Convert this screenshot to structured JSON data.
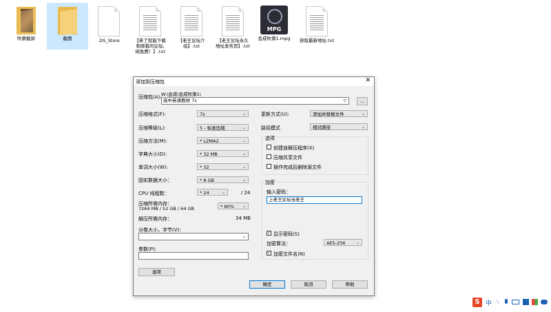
{
  "desktop": {
    "items": [
      {
        "label": "吹箫截屏"
      },
      {
        "label": "截图"
      },
      {
        "label": ".DS_Store"
      },
      {
        "label": "【来了就能下载\n和观看的论坛,\n纯免费！】.txt"
      },
      {
        "label": "【老王论坛介\n绍】.txt"
      },
      {
        "label": "【老王论坛永久\n地址发布页】.txt"
      },
      {
        "label": "会成吹箫1.mpg",
        "icon_text": "MPG"
      },
      {
        "label": "获取最新地址.txt"
      }
    ]
  },
  "dialog": {
    "title": "添加到压缩包",
    "close": "✕",
    "archive_label": "压缩包(A):",
    "archive_path": "W:\\会成\\会成吹箫1\\",
    "archive_name": "高中英语教材 7z",
    "browse": "...",
    "format_label": "压缩格式(F):",
    "format_value": "7z",
    "level_label": "压缩等级(L):",
    "level_value": "5 - 标准压缩",
    "method_label": "压缩方法(M):",
    "method_value": "* LZMA2",
    "dict_label": "字典大小(D):",
    "dict_value": "* 32 MB",
    "word_label": "单词大小(W):",
    "word_value": "* 32",
    "solid_label": "固实数据大小：",
    "solid_value": "* 8 GB",
    "cpu_label": "CPU 线程数：",
    "cpu_value": "* 24",
    "cpu_total": "/ 24",
    "mem_comp_label": "压缩所需内存：",
    "mem_comp_value": "7264 MB / 52 GB / 64 GB",
    "mem_percent": "* 80%",
    "mem_decomp_label": "解压所需内存：",
    "mem_decomp_value": "34 MB",
    "split_label": "分卷大小，字节(V):",
    "params_label": "参数(P):",
    "options_button": "选项",
    "update_label": "更新方式(U):",
    "update_value": "添加并替换文件",
    "path_label": "路径模式",
    "path_value": "相对路径",
    "options_group": "选项",
    "opt_sfx": "创建自解压程序(X)",
    "opt_shared": "压缩共享文件",
    "opt_delete": "操作完成后删除源文件",
    "encrypt_group": "加密",
    "pwd_label": "输入密码：",
    "pwd_value": "上老王论坛当老王",
    "show_pwd": "显示密码(S)",
    "enc_method_label": "加密算法：",
    "enc_method_value": "AES-256",
    "enc_names": "加密文件名(N)",
    "ok": "确定",
    "cancel": "取消",
    "help": "帮助"
  },
  "tray": {
    "ime": "中",
    "icons": [
      "S",
      "中",
      "·,",
      "mic",
      "keyboard",
      "shirt",
      "grid",
      "skin"
    ]
  }
}
